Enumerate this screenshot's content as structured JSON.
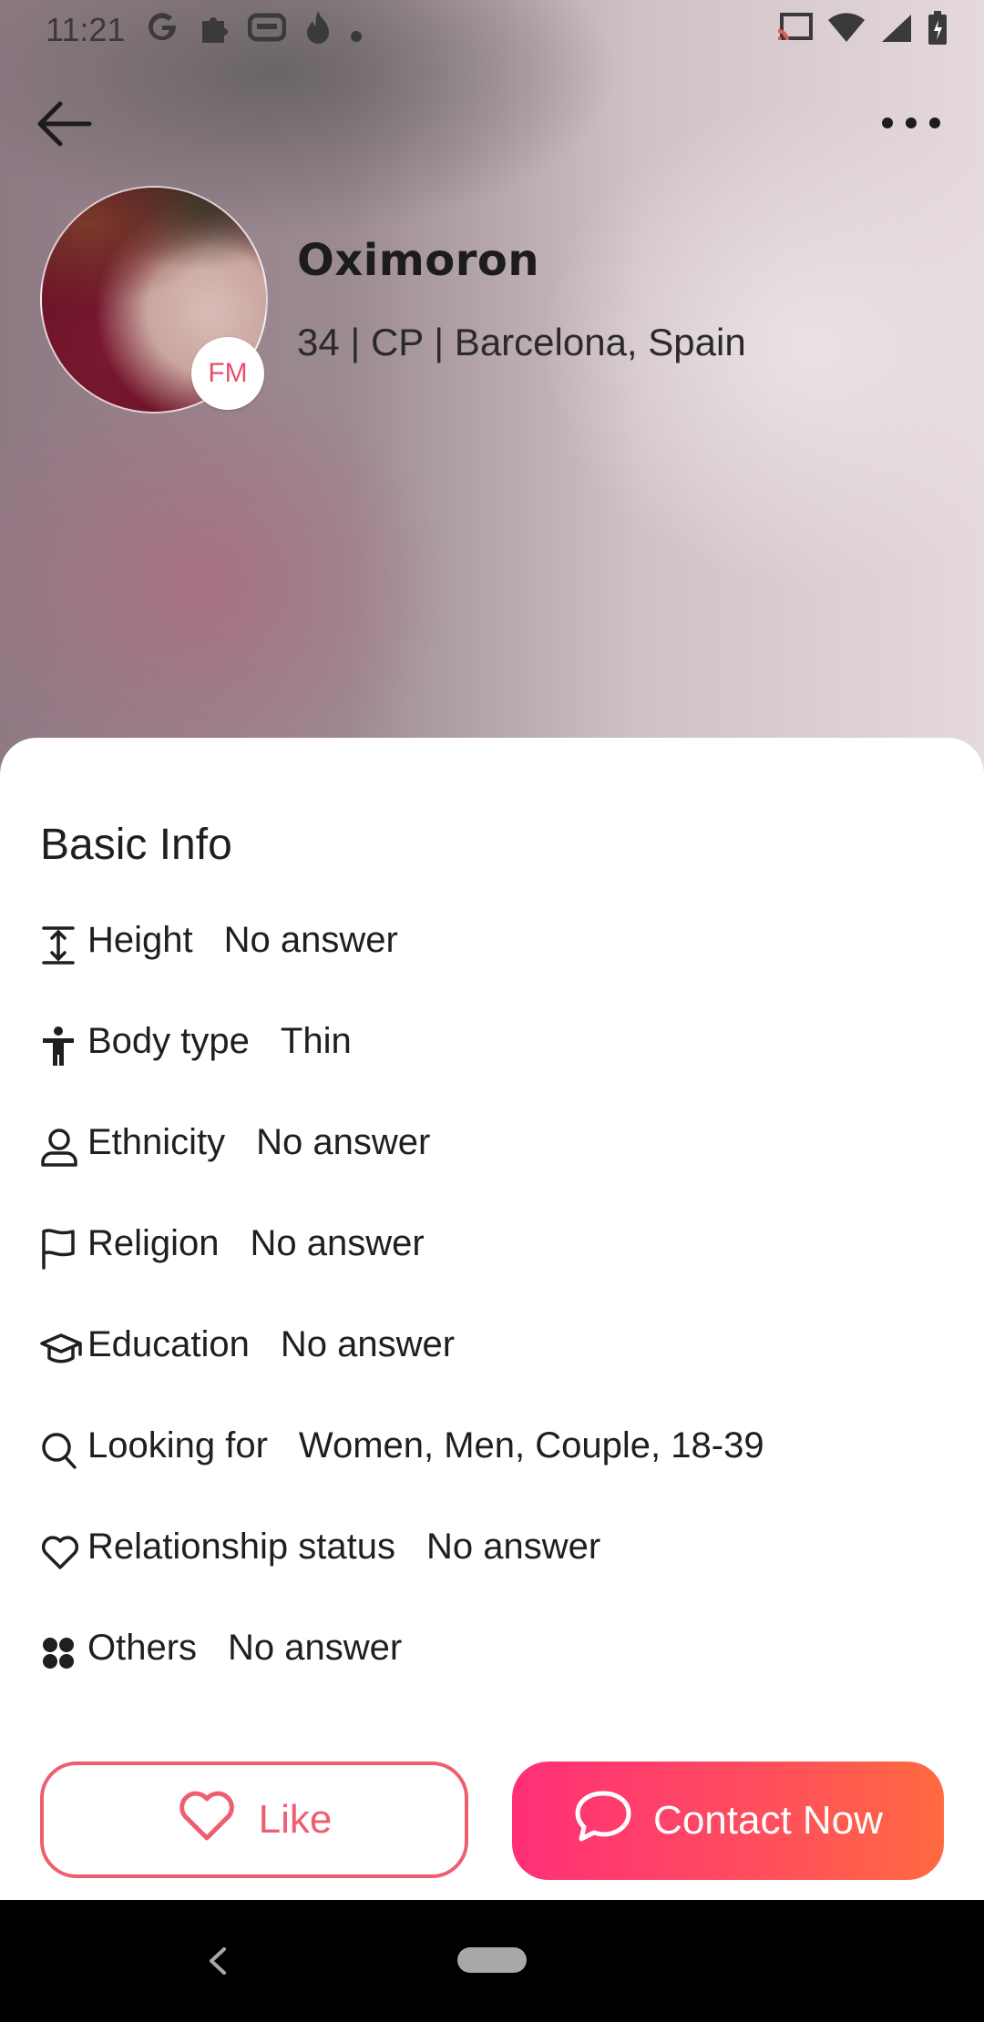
{
  "status_bar": {
    "time": "11:21",
    "left_icons": [
      "google-icon",
      "puzzle-icon",
      "gamepad-icon",
      "flame-icon",
      "dot-icon"
    ],
    "right_icons": [
      "cast-icon",
      "wifi-icon",
      "signal-icon",
      "battery-icon"
    ]
  },
  "header": {
    "back_icon": "arrow-left-icon",
    "more_icon": "more-horizontal-icon"
  },
  "profile": {
    "name": "Oximoron",
    "meta": "34 | CP | Barcelona, Spain",
    "badge": "FM"
  },
  "basic_info": {
    "title": "Basic Info",
    "rows": [
      {
        "icon": "height-icon",
        "label": "Height",
        "value": "No answer"
      },
      {
        "icon": "body-type-icon",
        "label": "Body type",
        "value": "Thin"
      },
      {
        "icon": "person-icon",
        "label": "Ethnicity",
        "value": "No answer"
      },
      {
        "icon": "flag-icon",
        "label": "Religion",
        "value": "No answer"
      },
      {
        "icon": "graduation-cap-icon",
        "label": "Education",
        "value": "No answer"
      },
      {
        "icon": "search-icon",
        "label": "Looking for",
        "value": "Women, Men, Couple, 18-39"
      },
      {
        "icon": "heart-outline-icon",
        "label": "Relationship status",
        "value": "No answer"
      },
      {
        "icon": "grid-icon",
        "label": "Others",
        "value": "No answer"
      }
    ]
  },
  "actions": {
    "like_label": "Like",
    "contact_label": "Contact Now"
  },
  "colors": {
    "accent": "#ef5d70",
    "contact_gradient_start": "#ff2f78",
    "contact_gradient_end": "#ff6a3f"
  }
}
